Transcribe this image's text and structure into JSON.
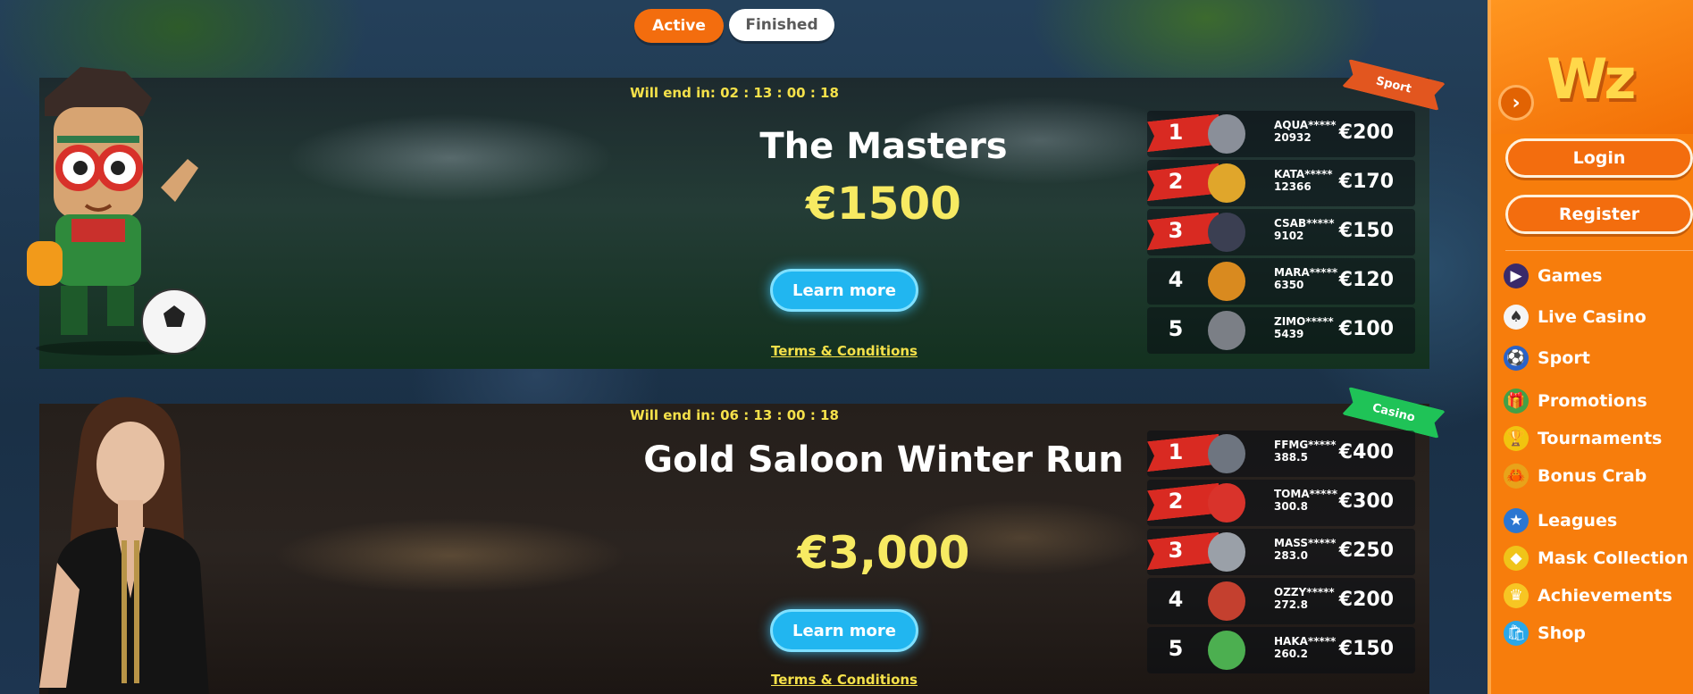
{
  "tabs": {
    "active": "Active",
    "finished": "Finished"
  },
  "tournaments": [
    {
      "countdown": "Will end in: 02 : 13 : 00 : 18",
      "title": "The Masters",
      "prize": "€1500",
      "learn_more": "Learn more",
      "terms": "Terms & Conditions",
      "category": "Sport",
      "leaderboard": [
        {
          "rank": "1",
          "name": "AQUA*****",
          "score": "20932",
          "prize": "€200"
        },
        {
          "rank": "2",
          "name": "KATA*****",
          "score": "12366",
          "prize": "€170"
        },
        {
          "rank": "3",
          "name": "CSAB*****",
          "score": "9102",
          "prize": "€150"
        },
        {
          "rank": "4",
          "name": "MARA*****",
          "score": "6350",
          "prize": "€120"
        },
        {
          "rank": "5",
          "name": "ZIMO*****",
          "score": "5439",
          "prize": "€100"
        }
      ]
    },
    {
      "countdown": "Will end in: 06 : 13 : 00 : 18",
      "title": "Gold Saloon Winter Run",
      "prize": "€3,000",
      "learn_more": "Learn more",
      "terms": "Terms & Conditions",
      "category": "Casino",
      "leaderboard": [
        {
          "rank": "1",
          "name": "FFMG*****",
          "score": "388.5",
          "prize": "€400"
        },
        {
          "rank": "2",
          "name": "TOMA*****",
          "score": "300.8",
          "prize": "€300"
        },
        {
          "rank": "3",
          "name": "MASS*****",
          "score": "283.0",
          "prize": "€250"
        },
        {
          "rank": "4",
          "name": "OZZY*****",
          "score": "272.8",
          "prize": "€200"
        },
        {
          "rank": "5",
          "name": "HAKA*****",
          "score": "260.2",
          "prize": "€150"
        }
      ]
    }
  ],
  "sidebar": {
    "logo": "Wz",
    "login": "Login",
    "register": "Register",
    "nav": [
      {
        "label": "Games",
        "icon": "games-icon"
      },
      {
        "label": "Live Casino",
        "icon": "live-casino-icon"
      },
      {
        "label": "Sport",
        "icon": "sport-icon"
      },
      {
        "label": "Promotions",
        "icon": "promotions-icon"
      },
      {
        "label": "Tournaments",
        "icon": "tournaments-icon"
      },
      {
        "label": "Bonus Crab",
        "icon": "bonus-crab-icon"
      },
      {
        "label": "Leagues",
        "icon": "leagues-icon"
      },
      {
        "label": "Mask Collection",
        "icon": "mask-collection-icon"
      },
      {
        "label": "Achievements",
        "icon": "achievements-icon"
      },
      {
        "label": "Shop",
        "icon": "shop-icon"
      }
    ]
  },
  "colors": {
    "brand_orange": "#f77d0c",
    "prize_yellow": "#f7ea62",
    "cta_blue": "#21b6f0",
    "rank_red": "#d92a22"
  }
}
